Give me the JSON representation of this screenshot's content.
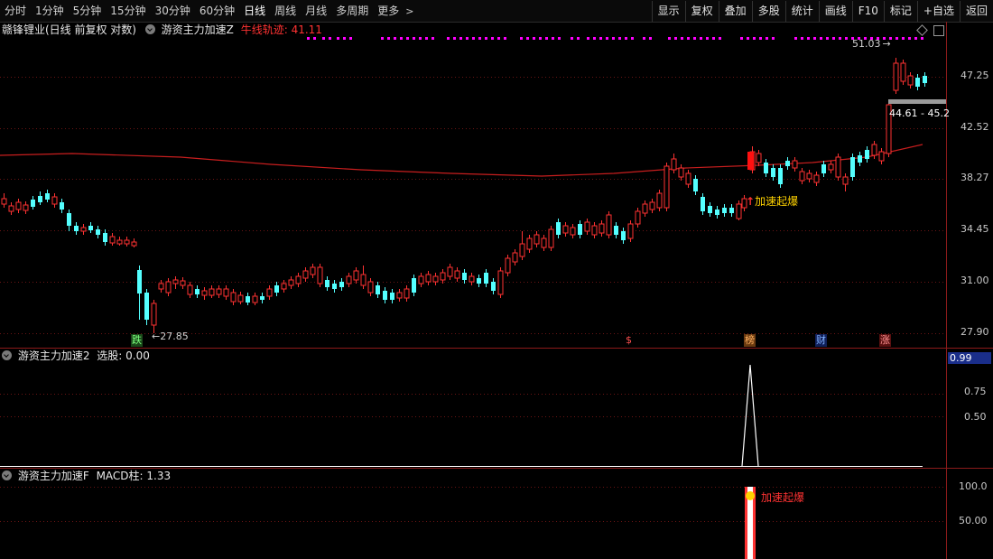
{
  "toolbar": {
    "periods": [
      "分时",
      "1分钟",
      "5分钟",
      "15分钟",
      "30分钟",
      "60分钟",
      "日线",
      "周线",
      "月线",
      "多周期",
      "更多"
    ],
    "active_period": "日线",
    "right_buttons": [
      "显示",
      "复权",
      "叠加",
      "多股",
      "统计",
      "画线",
      "F10",
      "标记",
      "+自选",
      "返回"
    ]
  },
  "main_panel": {
    "stock_label": "赣锋锂业(日线 前复权 对数)",
    "indicator_name": "游资主力加速Z",
    "indicator_value_label": "牛线轨迹: 41.11",
    "price_axis": [
      "47.25",
      "42.52",
      "38.27",
      "34.45",
      "31.00",
      "27.90"
    ],
    "high_label": "51.03",
    "low_label": "27.85",
    "range_label": "44.61 - 45.2",
    "signal_label": "加速起爆",
    "badges": [
      "跌",
      "$",
      "榜",
      "财",
      "涨"
    ]
  },
  "panel2": {
    "indicator_name": "游资主力加速2",
    "value_label": "选股: 0.00",
    "current_value": "0.99",
    "axis": [
      "0.75",
      "0.50"
    ]
  },
  "panel3": {
    "indicator_name": "游资主力加速F",
    "value_label": "MACD柱: 1.33",
    "axis": [
      "100.0",
      "50.00"
    ],
    "signal_label": "加速起爆"
  },
  "colors": {
    "up": "#ff3232",
    "down": "#54ffff",
    "ma": "#c81e1e",
    "grid": "#5a1010",
    "magenta": "#ff00ff",
    "yellow": "#ffd200"
  }
}
